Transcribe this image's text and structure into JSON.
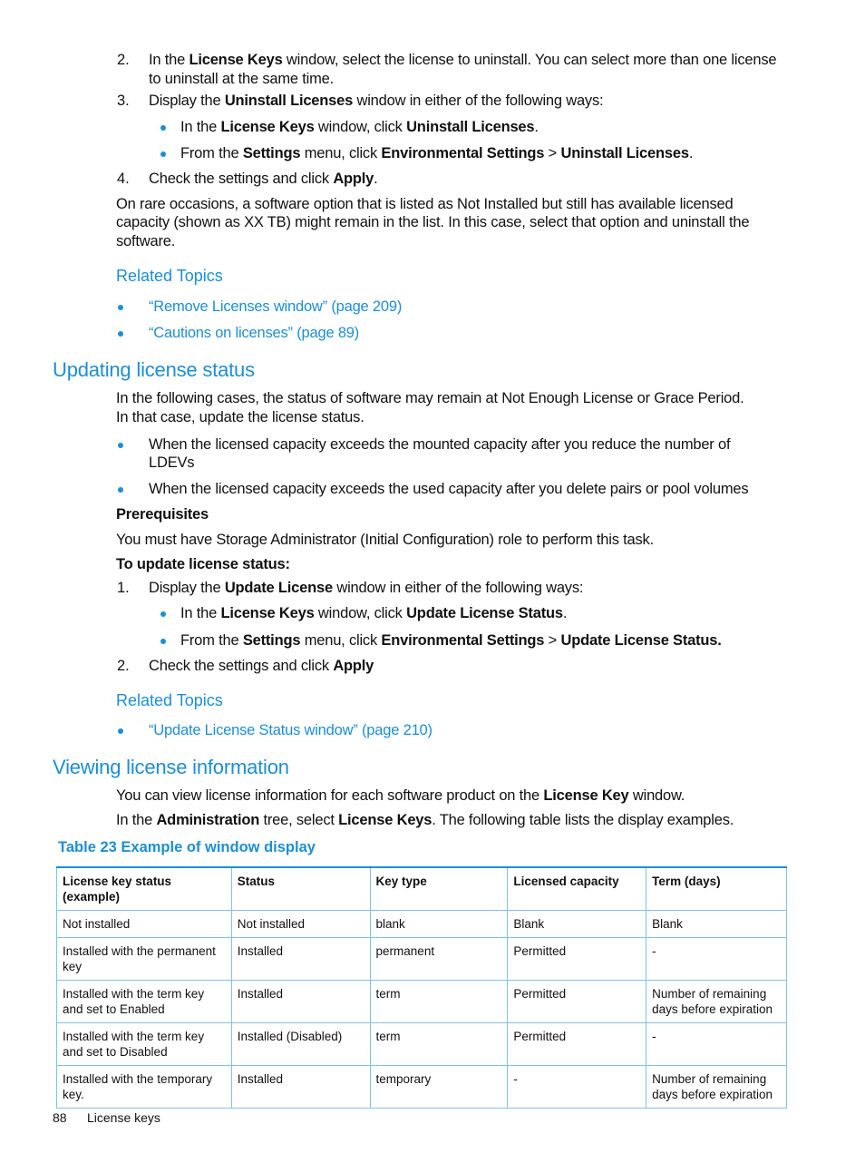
{
  "top_steps": {
    "step2": {
      "num": "2.",
      "line1_a": "In the ",
      "line1_b": "License Keys",
      "line1_c": " window, select the license to uninstall. You can select more than one license",
      "line2": "to uninstall at the same time."
    },
    "step3": {
      "num": "3.",
      "a": "Display the ",
      "b": "Uninstall Licenses",
      "c": " window in either of the following ways:",
      "bullets": [
        {
          "a": "In the ",
          "b": "License Keys",
          "c": " window, click ",
          "d": "Uninstall Licenses",
          "e": "."
        },
        {
          "a": "From the ",
          "b": "Settings",
          "c": " menu, click ",
          "d": "Environmental Settings",
          "e": " > ",
          "f": "Uninstall Licenses",
          "g": "."
        }
      ]
    },
    "step4": {
      "num": "4.",
      "a": "Check the settings and click ",
      "b": "Apply",
      "c": "."
    },
    "note_lines": [
      "On rare occasions, a software option that is listed as Not Installed but still has available licensed",
      "capacity (shown as XX TB) might remain in the list. In this case, select that option and uninstall the",
      "software."
    ]
  },
  "related_topics_1": {
    "heading": "Related Topics",
    "links": [
      "“Remove Licenses window” (page 209)",
      "“Cautions on licenses” (page 89)"
    ]
  },
  "updating": {
    "heading": "Updating license status",
    "intro_lines": [
      "In the following cases, the status of software may remain at Not Enough License or Grace Period.",
      "In that case, update the license status."
    ],
    "cases": [
      {
        "line1": "When the licensed capacity exceeds the mounted capacity after you reduce the number of",
        "line2": "LDEVs"
      },
      {
        "line1": "When the licensed capacity exceeds the used capacity after you delete pairs or pool volumes"
      }
    ],
    "prereq_heading": "Prerequisites",
    "prereq_text": "You must have Storage Administrator (Initial Configuration) role to perform this task.",
    "procedure_heading": "To update license status:",
    "step1": {
      "num": "1.",
      "a": "Display the ",
      "b": "Update License",
      "c": " window in either of the following ways:",
      "bullets": [
        {
          "a": "In the ",
          "b": "License Keys",
          "c": " window, click ",
          "d": "Update License Status",
          "e": "."
        },
        {
          "a": "From the ",
          "b": "Settings",
          "c": " menu, click ",
          "d": "Environmental Settings",
          "e": " > ",
          "f": "Update License Status."
        }
      ]
    },
    "step2": {
      "num": "2.",
      "a": "Check the settings and click ",
      "b": "Apply"
    }
  },
  "related_topics_2": {
    "heading": "Related Topics",
    "links": [
      "“Update License Status window” (page 210)"
    ]
  },
  "viewing": {
    "heading": "Viewing license information",
    "line1": {
      "a": "You can view license information for each software product on the ",
      "b": "License Key",
      "c": " window."
    },
    "line2": {
      "a": "In the ",
      "b": "Administration",
      "c": " tree, select ",
      "d": "License Keys",
      "e": ". The following table lists the display examples."
    }
  },
  "table": {
    "caption": "Table 23 Example of window display",
    "headers": [
      "License key status (example)",
      "Status",
      "Key type",
      "Licensed capacity",
      "Term (days)"
    ],
    "rows": [
      [
        "Not installed",
        "Not installed",
        "blank",
        "Blank",
        "Blank"
      ],
      [
        "Installed with the permanent key",
        "Installed",
        "permanent",
        "Permitted",
        "-"
      ],
      [
        "Installed with the term key and set to Enabled",
        "Installed",
        "term",
        "Permitted",
        "Number of remaining days before expiration"
      ],
      [
        "Installed with the term key and set to Disabled",
        "Installed (Disabled)",
        "term",
        "Permitted",
        "-"
      ],
      [
        "Installed with the temporary key.",
        "Installed",
        "temporary",
        "-",
        "Number of remaining days before expiration"
      ]
    ]
  },
  "footer": {
    "page_number": "88",
    "section": "License keys"
  },
  "colors": {
    "accent": "#1a8fd8",
    "table_border": "#7ec3ea",
    "text": "#111111"
  }
}
